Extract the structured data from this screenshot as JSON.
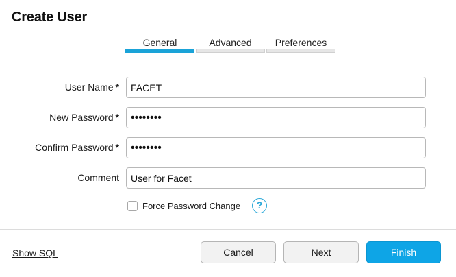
{
  "dialog": {
    "title": "Create User"
  },
  "tabs": [
    {
      "label": "General",
      "active": true
    },
    {
      "label": "Advanced",
      "active": false
    },
    {
      "label": "Preferences",
      "active": false
    }
  ],
  "form": {
    "user_name": {
      "label": "User Name",
      "required_mark": "*",
      "value": "FACET"
    },
    "new_password": {
      "label": "New Password",
      "required_mark": "*",
      "value": "••••••••"
    },
    "confirm_password": {
      "label": "Confirm Password",
      "required_mark": "*",
      "value": "••••••••"
    },
    "comment": {
      "label": "Comment",
      "value": "User for Facet"
    },
    "force_password_change": {
      "label": "Force Password Change",
      "checked": false,
      "help_icon": "question-mark"
    }
  },
  "footer": {
    "show_sql_label": "Show SQL",
    "cancel_label": "Cancel",
    "next_label": "Next",
    "finish_label": "Finish"
  },
  "colors": {
    "accent": "#0ea5e6",
    "active_tab": "#1aa3d8"
  }
}
